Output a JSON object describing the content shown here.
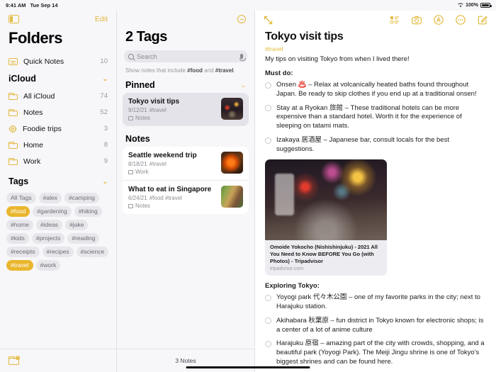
{
  "statusbar": {
    "time": "9:41 AM",
    "date": "Tue Sep 14",
    "battery_pct": "100%",
    "wifi_icon": "wifi-icon",
    "battery_icon": "battery-icon"
  },
  "sidebar": {
    "toggle_icon": "sidebar-toggle-icon",
    "edit_label": "Edit",
    "title": "Folders",
    "quick_notes": {
      "label": "Quick Notes",
      "count": "10",
      "icon": "quick-note-icon"
    },
    "icloud_section": {
      "label": "iCloud",
      "chevron": "⌄"
    },
    "folders": [
      {
        "label": "All iCloud",
        "count": "74",
        "icon": "folder-icon"
      },
      {
        "label": "Notes",
        "count": "52",
        "icon": "folder-icon"
      },
      {
        "label": "Foodie trips",
        "count": "3",
        "icon": "smart-folder-icon"
      },
      {
        "label": "Home",
        "count": "8",
        "icon": "folder-icon"
      },
      {
        "label": "Work",
        "count": "9",
        "icon": "folder-icon"
      }
    ],
    "tags_section": {
      "label": "Tags",
      "chevron": "⌄"
    },
    "tags": [
      {
        "label": "All Tags",
        "selected": false
      },
      {
        "label": "#alex",
        "selected": false
      },
      {
        "label": "#camping",
        "selected": false
      },
      {
        "label": "#food",
        "selected": true
      },
      {
        "label": "#gardening",
        "selected": false
      },
      {
        "label": "#hiking",
        "selected": false
      },
      {
        "label": "#home",
        "selected": false
      },
      {
        "label": "#ideas",
        "selected": false
      },
      {
        "label": "#jake",
        "selected": false
      },
      {
        "label": "#kids",
        "selected": false
      },
      {
        "label": "#projects",
        "selected": false
      },
      {
        "label": "#reading",
        "selected": false
      },
      {
        "label": "#receipts",
        "selected": false
      },
      {
        "label": "#recipes",
        "selected": false
      },
      {
        "label": "#science",
        "selected": false
      },
      {
        "label": "#travel",
        "selected": true
      },
      {
        "label": "#work",
        "selected": false
      }
    ],
    "new_folder_icon": "new-folder-icon"
  },
  "notelist": {
    "collapse_icon": "remove-circle-icon",
    "title": "2 Tags",
    "search": {
      "placeholder": "Search",
      "icon": "search-icon",
      "mic_icon": "microphone-icon"
    },
    "filter_prefix": "Show notes that include ",
    "filter_tag1": "#food",
    "filter_middle": " and ",
    "filter_tag2": "#travel",
    "filter_suffix": ".",
    "pinned_section": {
      "label": "Pinned",
      "chevron": "⌄"
    },
    "notes_section": {
      "label": "Notes",
      "chevron": ""
    },
    "pinned_notes": [
      {
        "title": "Tokyo visit tips",
        "date": "9/12/21",
        "tags": "#travel",
        "folder": "Notes",
        "thumb": "tokyo",
        "selected": true
      }
    ],
    "notes": [
      {
        "title": "Seattle weekend trip",
        "date": "8/18/21",
        "tags": "#travel",
        "folder": "Work",
        "thumb": "seattle",
        "selected": false
      },
      {
        "title": "What to eat in Singapore",
        "date": "6/24/21",
        "tags": "#food #travel",
        "folder": "Notes",
        "thumb": "singapore",
        "selected": false
      }
    ],
    "count_label": "3 Notes"
  },
  "detail": {
    "expand_icon": "expand-icon",
    "tools": [
      {
        "name": "checklist-icon"
      },
      {
        "name": "camera-icon"
      },
      {
        "name": "markup-icon"
      },
      {
        "name": "more-options-icon"
      },
      {
        "name": "compose-icon"
      }
    ],
    "title": "Tokyo visit tips",
    "tag": "#travel",
    "intro": "My tips on visiting Tokyo from when I lived there!",
    "section1_heading": "Must do:",
    "section1_items": [
      "Onsen ♨️ – Relax at volcanically heated baths found throughout Japan. Be ready to skip clothes if you end up at a traditional onsen!",
      "Stay at a Ryokan 旅館 – These traditional hotels can be more expensive than a standard hotel. Worth it for the experience of sleeping on tatami mats.",
      "Izakaya 居酒屋 – Japanese bar, consult locals for the best suggestions."
    ],
    "link_preview": {
      "title": "Omoide Yokocho (Nishishinjuku) - 2021 All You Need to Know BEFORE You Go (with Photos) - Tripadvisor",
      "url": "tripadvisor.com"
    },
    "section2_heading": "Exploring Tokyo:",
    "section2_items": [
      "Yoyogi park 代々木公園 – one of my favorite parks in the city; next to Harajuku station.",
      "Akihabara 秋葉原 – fun district in Tokyo known for electronic shops; is a center of a lot of anime culture",
      "Harajuku 原宿 – amazing part of the city with crowds, shopping, and a beautiful park (Yoyogi Park). The Meiji Jingu shrine is one of Tokyo's biggest shrines and can be found here."
    ]
  },
  "colors": {
    "accent": "#E3B93C",
    "tag_selected": "#E9B62D",
    "pill_bg": "#E7E6EB",
    "sidebar_bg": "#F7F6F9"
  }
}
